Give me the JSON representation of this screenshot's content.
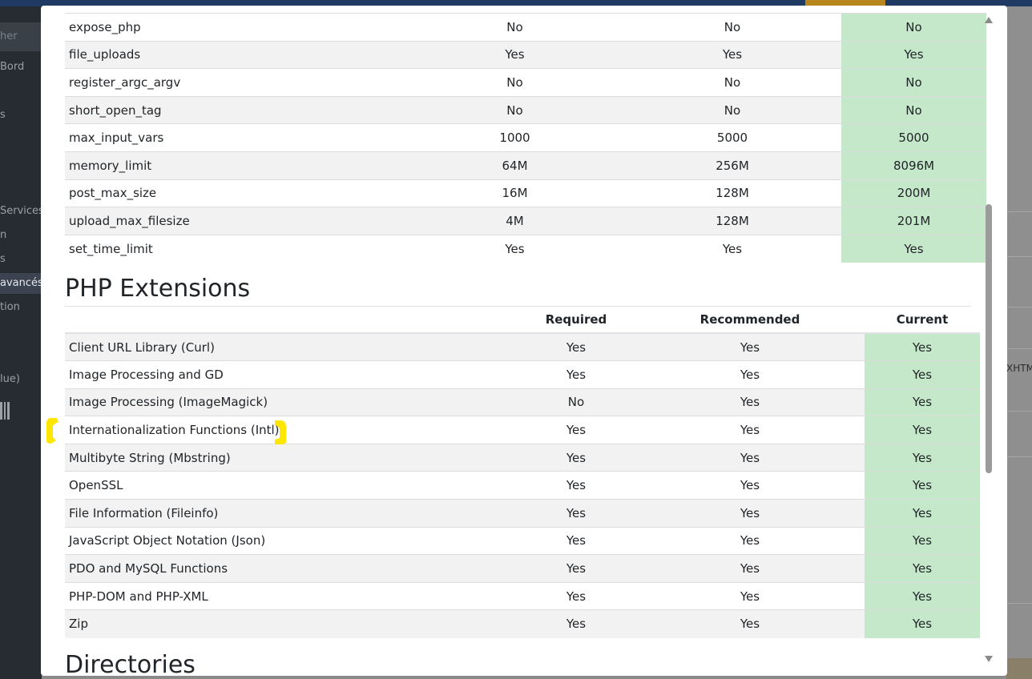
{
  "background": {
    "sidebar_items": [
      "her",
      "Bord",
      "s",
      "Services",
      "n",
      "s",
      "avancés",
      "tion",
      "lue)"
    ],
    "right_text": "XHTM"
  },
  "config_rows": [
    {
      "name": "expose_php",
      "required": "No",
      "recommended": "No",
      "current": "No"
    },
    {
      "name": "file_uploads",
      "required": "Yes",
      "recommended": "Yes",
      "current": "Yes"
    },
    {
      "name": "register_argc_argv",
      "required": "No",
      "recommended": "No",
      "current": "No"
    },
    {
      "name": "short_open_tag",
      "required": "No",
      "recommended": "No",
      "current": "No"
    },
    {
      "name": "max_input_vars",
      "required": "1000",
      "recommended": "5000",
      "current": "5000"
    },
    {
      "name": "memory_limit",
      "required": "64M",
      "recommended": "256M",
      "current": "8096M"
    },
    {
      "name": "post_max_size",
      "required": "16M",
      "recommended": "128M",
      "current": "200M"
    },
    {
      "name": "upload_max_filesize",
      "required": "4M",
      "recommended": "128M",
      "current": "201M"
    },
    {
      "name": "set_time_limit",
      "required": "Yes",
      "recommended": "Yes",
      "current": "Yes"
    }
  ],
  "extensions": {
    "title": "PHP Extensions",
    "headers": {
      "name": "",
      "required": "Required",
      "recommended": "Recommended",
      "current": "Current"
    },
    "rows": [
      {
        "name": "Client URL Library (Curl)",
        "required": "Yes",
        "recommended": "Yes",
        "current": "Yes"
      },
      {
        "name": "Image Processing and GD",
        "required": "Yes",
        "recommended": "Yes",
        "current": "Yes"
      },
      {
        "name": "Image Processing (ImageMagick)",
        "required": "No",
        "recommended": "Yes",
        "current": "Yes"
      },
      {
        "name": "Internationalization Functions (Intl)",
        "required": "Yes",
        "recommended": "Yes",
        "current": "Yes"
      },
      {
        "name": "Multibyte String (Mbstring)",
        "required": "Yes",
        "recommended": "Yes",
        "current": "Yes"
      },
      {
        "name": "OpenSSL",
        "required": "Yes",
        "recommended": "Yes",
        "current": "Yes"
      },
      {
        "name": "File Information (Fileinfo)",
        "required": "Yes",
        "recommended": "Yes",
        "current": "Yes"
      },
      {
        "name": "JavaScript Object Notation (Json)",
        "required": "Yes",
        "recommended": "Yes",
        "current": "Yes"
      },
      {
        "name": "PDO and MySQL Functions",
        "required": "Yes",
        "recommended": "Yes",
        "current": "Yes"
      },
      {
        "name": "PHP-DOM and PHP-XML",
        "required": "Yes",
        "recommended": "Yes",
        "current": "Yes"
      },
      {
        "name": "Zip",
        "required": "Yes",
        "recommended": "Yes",
        "current": "Yes"
      }
    ]
  },
  "next_section_title": "Directories",
  "colors": {
    "current_cell": "#c6e8ca",
    "stripe": "#f2f2f2",
    "highlight_marker": "#ffe600"
  }
}
